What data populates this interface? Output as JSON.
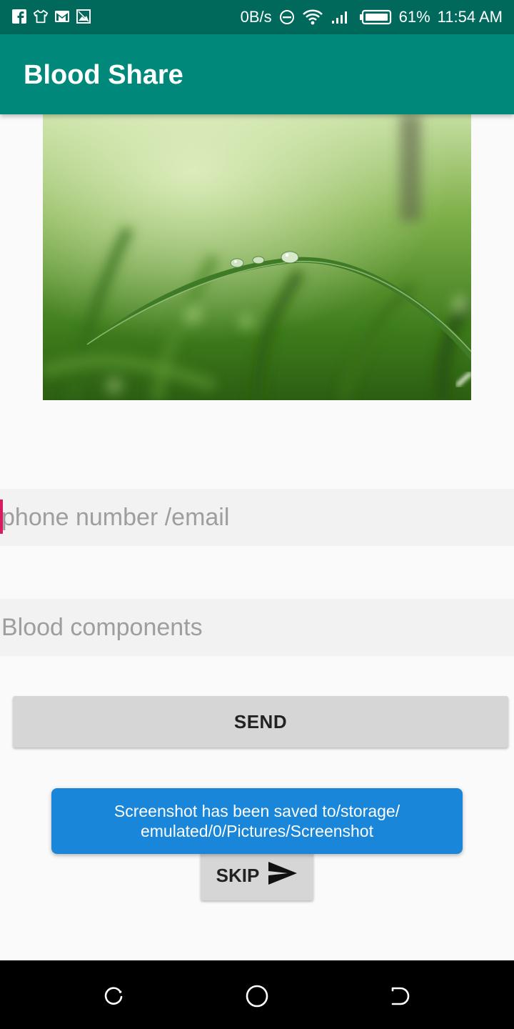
{
  "status_bar": {
    "network_speed": "0B/s",
    "battery_percent": "61%",
    "time": "11:54 AM"
  },
  "app_bar": {
    "title": "Blood Share"
  },
  "form": {
    "contact_placeholder": "phone number /email",
    "components_placeholder": "Blood components",
    "send_label": "SEND",
    "skip_label": "SKIP"
  },
  "toast": {
    "line1": "Screenshot has been saved to/storage/",
    "line2": "emulated/0/Pictures/Screenshot"
  },
  "colors": {
    "status_bar": "#00695c",
    "app_bar": "#00897b",
    "cursor_accent": "#d81b60",
    "toast": "#1a86d9"
  }
}
